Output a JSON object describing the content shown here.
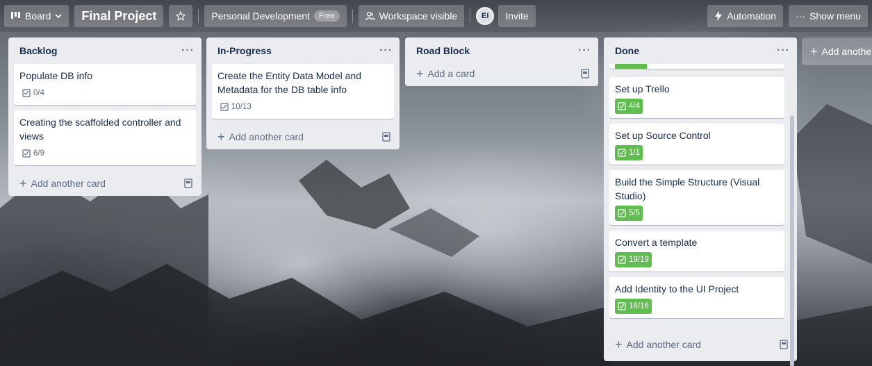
{
  "topbar": {
    "board_menu_label": "Board",
    "board_title": "Final Project",
    "workspace_name": "Personal Development",
    "workspace_badge": "Free",
    "visibility_label": "Workspace visible",
    "avatar_initials": "EI",
    "invite_label": "Invite",
    "automation_label": "Automation",
    "show_menu_label": "Show menu"
  },
  "lists": [
    {
      "title": "Backlog",
      "cards": [
        {
          "title": "Populate DB info",
          "checklist": "0/4",
          "complete": false
        },
        {
          "title": "Creating the scaffolded controller and views",
          "checklist": "6/9",
          "complete": false
        }
      ],
      "add_card_label": "Add another card"
    },
    {
      "title": "In-Progress",
      "cards": [
        {
          "title": "Create the Entity Data Model and Metadata for the DB table info",
          "checklist": "10/13",
          "complete": false
        }
      ],
      "add_card_label": "Add another card"
    },
    {
      "title": "Road Block",
      "cards": [],
      "add_card_label": "Add a card"
    },
    {
      "title": "Done",
      "cards": [
        {
          "title": "Set up Trello",
          "checklist": "4/4",
          "complete": true
        },
        {
          "title": "Set up Source Control",
          "checklist": "1/1",
          "complete": true
        },
        {
          "title": "Build the Simple Structure (Visual Studio)",
          "checklist": "5/5",
          "complete": true
        },
        {
          "title": "Convert a template",
          "checklist": "19/19",
          "complete": true
        },
        {
          "title": "Add Identity to the UI Project",
          "checklist": "16/16",
          "complete": true
        }
      ],
      "add_card_label": "Add another card"
    }
  ],
  "add_list_label": "Add another list",
  "colors": {
    "list_bg": "#ebecf0",
    "card_bg": "#ffffff",
    "complete_badge": "#61bd4f",
    "text": "#172b4d"
  }
}
